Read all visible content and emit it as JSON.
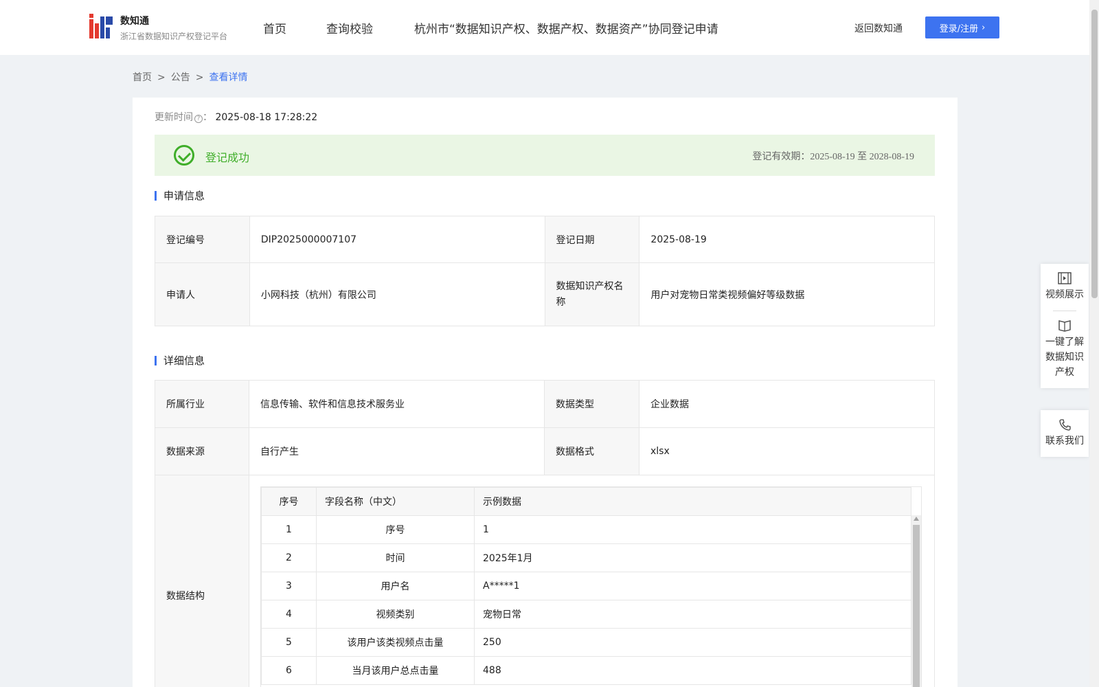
{
  "header": {
    "logo_title": "数知通",
    "logo_subtitle": "浙江省数据知识产权登记平台",
    "nav": [
      "首页",
      "查询校验",
      "杭州市“数据知识产权、数据产权、数据资产”协同登记申请"
    ],
    "back_link": "返回数知通",
    "login_label": "登录/注册"
  },
  "breadcrumb": [
    "首页",
    "公告",
    "查看详情"
  ],
  "update": {
    "label": "更新时间",
    "value": "2025-08-18 17:28:22"
  },
  "status": {
    "text": "登记成功",
    "validity_label": "登记有效期：",
    "validity_value": "2025-08-19 至 2028-08-19"
  },
  "application": {
    "title": "申请信息",
    "reg_no_label": "登记编号",
    "reg_no": "DIP2025000007107",
    "reg_date_label": "登记日期",
    "reg_date": "2025-08-19",
    "applicant_label": "申请人",
    "applicant": "小网科技（杭州）有限公司",
    "ip_name_label": "数据知识产权名称",
    "ip_name": "用户对宠物日常类视频偏好等级数据"
  },
  "details": {
    "title": "详细信息",
    "industry_label": "所属行业",
    "industry": "信息传输、软件和信息技术服务业",
    "data_type_label": "数据类型",
    "data_type": "企业数据",
    "source_label": "数据来源",
    "source": "自行产生",
    "format_label": "数据格式",
    "format": "xlsx",
    "structure_label": "数据结构",
    "structure_headers": [
      "序号",
      "字段名称（中文）",
      "示例数据"
    ],
    "structure_rows": [
      [
        "1",
        "序号",
        "1"
      ],
      [
        "2",
        "时间",
        "2025年1月"
      ],
      [
        "3",
        "用户名",
        "A*****1"
      ],
      [
        "4",
        "视频类别",
        "宠物日常"
      ],
      [
        "5",
        "该用户该类视频点击量",
        "250"
      ],
      [
        "6",
        "当月该用户总点击量",
        "488"
      ]
    ]
  },
  "float_panel": {
    "video": "视频展示",
    "learn": "一键了解数据知识产权",
    "contact": "联系我们"
  }
}
